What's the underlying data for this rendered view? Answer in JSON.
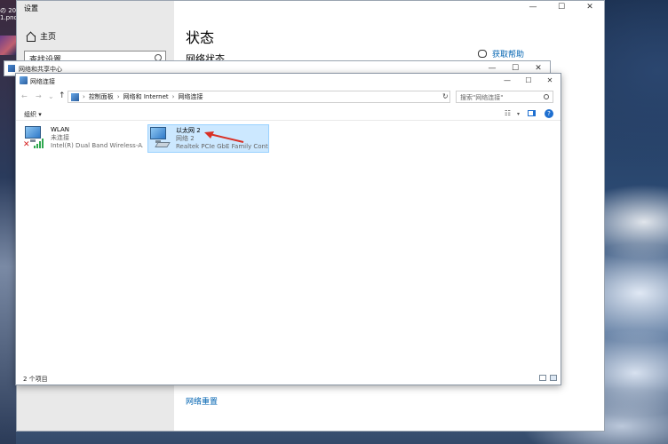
{
  "desktop": {
    "thumb_text": "の 20\n1.pnc"
  },
  "settings": {
    "title": "设置",
    "home_label": "主页",
    "search_placeholder": "查找设置",
    "page_title": "状态",
    "section_title": "网络状态",
    "help_label": "获取帮助",
    "reset_label": "网络重置",
    "controls": {
      "minimize": "—",
      "maximize": "☐",
      "close": "✕"
    }
  },
  "sharing_center": {
    "title": "网络和共享中心"
  },
  "connections_window": {
    "title": "网络连接",
    "breadcrumb": [
      "控制面板",
      "网络和 Internet",
      "网络连接"
    ],
    "search_placeholder": "搜索\"网络连接\"",
    "organize_label": "组织 ▾",
    "items": [
      {
        "name": "WLAN",
        "status": "未连接",
        "device": "Intel(R) Dual Band Wireless-A...",
        "type": "wireless",
        "selected": false
      },
      {
        "name": "以太网 2",
        "status": "网络 2",
        "device": "Realtek PCIe GbE Family Contr...",
        "type": "ethernet",
        "selected": true
      }
    ],
    "item_count": "2 个项目",
    "annotation_color": "#d93025"
  }
}
